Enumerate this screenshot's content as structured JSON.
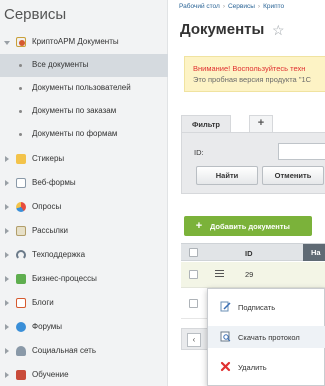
{
  "sidebar": {
    "title": "Сервисы",
    "items": [
      {
        "label": "КриптоАРМ Документы",
        "icon": "crypto-icon",
        "expanded": true
      },
      {
        "label": "Стикеры",
        "icon": "sticker-icon"
      },
      {
        "label": "Веб-формы",
        "icon": "webform-icon"
      },
      {
        "label": "Опросы",
        "icon": "poll-icon"
      },
      {
        "label": "Рассылки",
        "icon": "mail-icon"
      },
      {
        "label": "Техподдержка",
        "icon": "headset-icon"
      },
      {
        "label": "Бизнес-процессы",
        "icon": "bizproc-icon"
      },
      {
        "label": "Блоги",
        "icon": "blog-icon"
      },
      {
        "label": "Форумы",
        "icon": "forum-icon"
      },
      {
        "label": "Социальная сеть",
        "icon": "social-icon"
      },
      {
        "label": "Обучение",
        "icon": "learning-icon"
      }
    ],
    "subitems": [
      {
        "label": "Все документы",
        "active": true
      },
      {
        "label": "Документы пользователей"
      },
      {
        "label": "Документы по заказам"
      },
      {
        "label": "Документы по формам"
      }
    ]
  },
  "breadcrumbs": [
    "Рабочий стол",
    "Сервисы",
    "Крипто"
  ],
  "page": {
    "title": "Документы"
  },
  "alert": {
    "title": "Внимание! Воспользуйтесь техн",
    "text": "Это пробная версия продукта \"1С"
  },
  "filter": {
    "tab_label": "Фильтр",
    "add_tab": "+",
    "id_label": "ID:",
    "find_button": "Найти",
    "cancel_button": "Отменить"
  },
  "toolbar": {
    "add_label": "Добавить документы",
    "add_icon": "+"
  },
  "grid": {
    "column_id": "ID",
    "column_dark": "На",
    "rows": [
      {
        "id": "29"
      }
    ],
    "pager_prev": "‹"
  },
  "context_menu": {
    "items": [
      {
        "label": "Подписать",
        "icon": "sign-icon"
      },
      {
        "label": "Скачать протокол",
        "icon": "download-protocol-icon"
      },
      {
        "label": "Удалить",
        "icon": "delete-icon"
      }
    ]
  },
  "colors": {
    "add_button": "#7bb23a",
    "alert_bg": "#fdf3c5",
    "alert_title": "#e03030",
    "sidebar_bg": "#f2f3f4",
    "active_item": "#d5dadf"
  }
}
